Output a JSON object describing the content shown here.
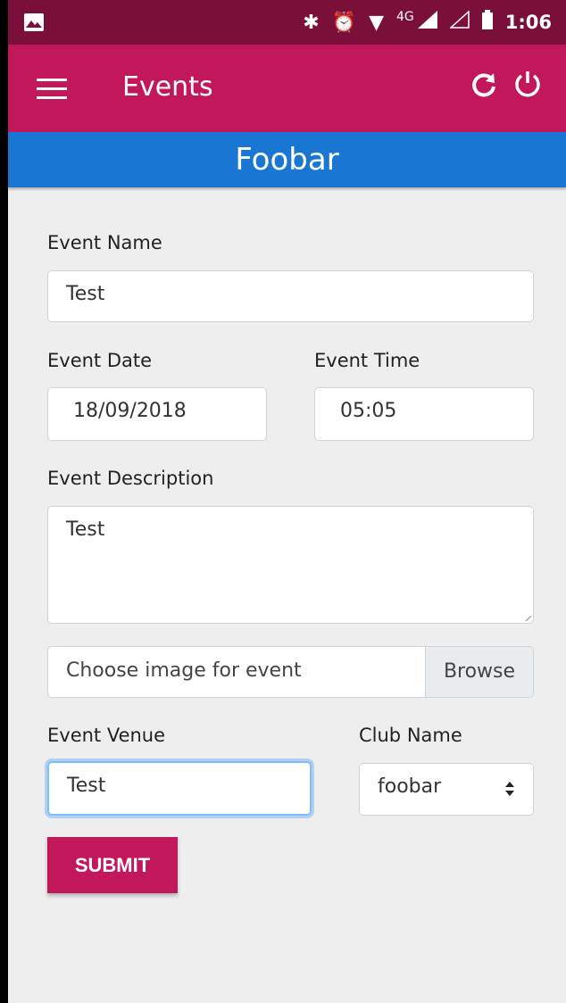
{
  "status_bar": {
    "time": "1:06",
    "network": "4G",
    "icons": [
      "image-icon",
      "bluetooth-icon",
      "alarm-icon",
      "wifi-icon",
      "signal-icon",
      "signal-empty-icon",
      "battery-icon"
    ]
  },
  "app_bar": {
    "title": "Events",
    "icons": [
      "menu-icon",
      "refresh-icon",
      "power-icon"
    ]
  },
  "banner": {
    "title": "Foobar"
  },
  "form": {
    "event_name": {
      "label": "Event Name",
      "value": "Test"
    },
    "event_date": {
      "label": "Event Date",
      "value": "18/09/2018"
    },
    "event_time": {
      "label": "Event Time",
      "value": "05:05"
    },
    "event_description": {
      "label": "Event Description",
      "value": "Test"
    },
    "image": {
      "placeholder": "Choose image for event",
      "browse_label": "Browse"
    },
    "event_venue": {
      "label": "Event Venue",
      "value": "Test"
    },
    "club_name": {
      "label": "Club Name",
      "value": "foobar"
    },
    "submit_label": "SUBMIT"
  },
  "colors": {
    "status_bar": "#7a0f3a",
    "app_bar": "#c2185b",
    "banner": "#1976d2",
    "background": "#eeeeee",
    "focus_border": "#80bdff"
  }
}
